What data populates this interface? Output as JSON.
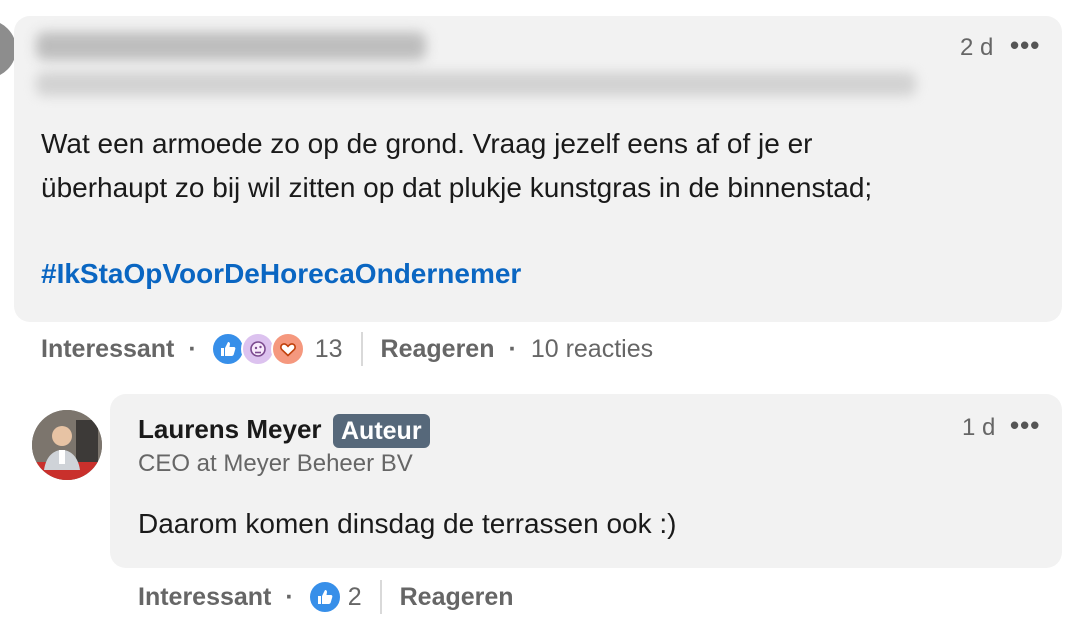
{
  "comment1": {
    "time": "2 d",
    "more": "•••",
    "text_line1": "Wat een armoede zo op de grond. Vraag jezelf eens af of je er",
    "text_line2": "überhaupt zo bij wil zitten op dat plukje kunstgras in de binnenstad;",
    "hashtag": "#IkStaOpVoorDeHorecaOndernemer",
    "actions": {
      "react_label": "Interessant",
      "reaction_count": "13",
      "reply_label": "Reageren",
      "replies_count": "10 reacties"
    }
  },
  "comment2": {
    "author": "Laurens Meyer",
    "badge": "Auteur",
    "headline": "CEO at Meyer Beheer BV",
    "time": "1 d",
    "more": "•••",
    "text": "Daarom komen dinsdag de terrassen ook :)",
    "actions": {
      "react_label": "Interessant",
      "reaction_count": "2",
      "reply_label": "Reageren"
    }
  },
  "colors": {
    "bubble": "#f2f2f2",
    "link": "#0a66c2",
    "badge": "#56687a",
    "like": "#378fe9",
    "curious": "#dcc2ef",
    "love": "#f5987e"
  }
}
